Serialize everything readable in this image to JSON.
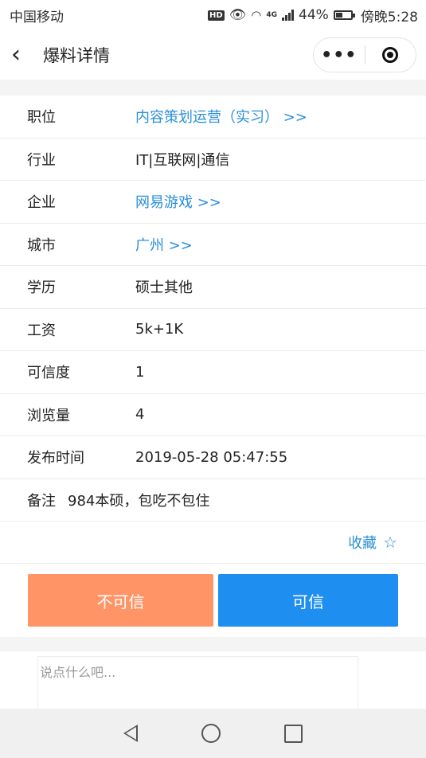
{
  "status": {
    "carrier": "中国移动",
    "net": "4G",
    "battery": "44%",
    "time": "傍晚5:28",
    "battery_level": 0.44
  },
  "nav": {
    "title": "爆料详情"
  },
  "details": [
    {
      "label": "职位",
      "value": "内容策划运营（实习） >>",
      "link": true
    },
    {
      "label": "行业",
      "value": "IT|互联网|通信",
      "link": false
    },
    {
      "label": "企业",
      "value": "网易游戏 >>",
      "link": true
    },
    {
      "label": "城市",
      "value": "广州 >>",
      "link": true
    },
    {
      "label": "学历",
      "value": "硕士其他",
      "link": false
    },
    {
      "label": "工资",
      "value": "5k+1K",
      "link": false
    },
    {
      "label": "可信度",
      "value": "1",
      "link": false
    },
    {
      "label": "浏览量",
      "value": "4",
      "link": false
    },
    {
      "label": "发布时间",
      "value": "2019-05-28 05:47:55",
      "link": false
    }
  ],
  "note": {
    "label": "备注",
    "value": "984本硕，包吃不包住"
  },
  "favorite": {
    "label": "收藏"
  },
  "buttons": {
    "untrusted": "不可信",
    "trusted": "可信"
  },
  "comment": {
    "placeholder": "说点什么吧..."
  },
  "colors": {
    "link": "#2b8fd8",
    "untrusted_btn": "#ff9467",
    "trusted_btn": "#1e8ef0"
  }
}
